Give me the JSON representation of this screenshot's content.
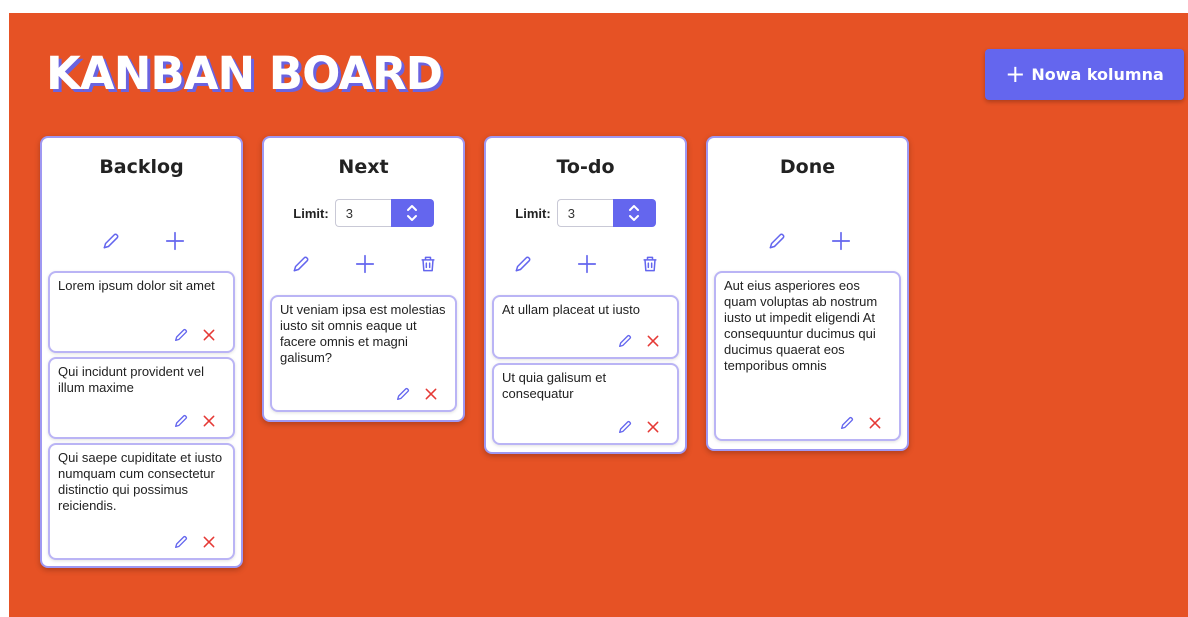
{
  "header": {
    "title": "KANBAN BOARD",
    "add_column_label": "Nowa kolumna"
  },
  "colors": {
    "background": "#e65225",
    "accent": "#6466ee",
    "delete": "#e53935"
  },
  "columns": [
    {
      "title": "Backlog",
      "cards": [
        "Lorem ipsum dolor sit amet",
        "Qui incidunt provident vel illum maxime",
        "Qui saepe cupiditate et iusto numquam cum consectetur distinctio qui possimus reiciendis."
      ]
    },
    {
      "title": "Next",
      "limit_label": "Limit:",
      "limit_value": "3",
      "cards": [
        "Ut veniam ipsa est molestias iusto sit omnis eaque ut facere omnis et magni galisum?"
      ]
    },
    {
      "title": "To-do",
      "limit_label": "Limit:",
      "limit_value": "3",
      "cards": [
        "At ullam placeat ut iusto",
        "Ut quia galisum et consequatur"
      ]
    },
    {
      "title": "Done",
      "cards": [
        "Aut eius asperiores eos quam voluptas ab nostrum iusto ut impedit eligendi At consequuntur ducimus qui ducimus quaerat eos temporibus omnis"
      ]
    }
  ],
  "icons": {
    "edit": "pencil-icon",
    "add": "plus-icon",
    "delete_column": "trash-icon",
    "delete_card": "close-icon",
    "stepper": "chevron-up-down-icon"
  }
}
